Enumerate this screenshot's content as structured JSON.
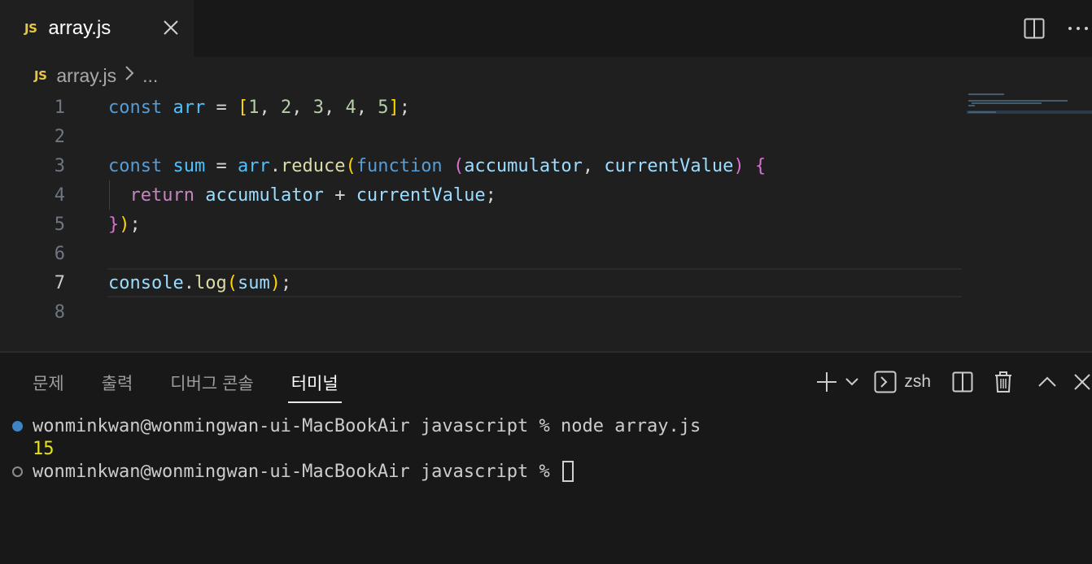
{
  "tab": {
    "badge": "JS",
    "title": "array.js"
  },
  "breadcrumb": {
    "badge": "JS",
    "file": "array.js",
    "more": "..."
  },
  "editor": {
    "line_numbers": [
      "1",
      "2",
      "3",
      "4",
      "5",
      "6",
      "7",
      "8"
    ],
    "active_line": "7",
    "lines": {
      "l1": [
        "const",
        "arr",
        "=",
        "[",
        "1",
        "2",
        "3",
        "4",
        "5",
        "]",
        ";"
      ],
      "l3": [
        "const",
        "sum",
        "=",
        "arr",
        "reduce",
        "(",
        "function",
        "(",
        "accumulator",
        "currentValue",
        ")",
        "{"
      ],
      "l4": [
        "return",
        "accumulator",
        "+",
        "currentValue",
        ";"
      ],
      "l5": [
        "}",
        ")",
        ";"
      ],
      "l7": [
        "console",
        "log",
        "(",
        "sum",
        ")",
        ";"
      ]
    }
  },
  "panel": {
    "tabs": [
      "문제",
      "출력",
      "디버그 콘솔",
      "터미널"
    ],
    "active_tab": "터미널",
    "shell": "zsh"
  },
  "terminal": {
    "prompt1": "wonminkwan@wonmingwan-ui-MacBookAir javascript % node array.js",
    "output": "15",
    "prompt2": "wonminkwan@wonmingwan-ui-MacBookAir javascript % "
  },
  "colors": {
    "keyword": "#569cd6",
    "return": "#c586c0",
    "variable": "#4fc1ff",
    "parameter": "#9cdcfe",
    "function": "#dcdcaa",
    "number": "#b5cea8",
    "bracket1": "#ffd700",
    "bracket2": "#da70d6",
    "bracket3": "#179fff",
    "js_badge": "#e8c54b",
    "terminal_output": "#e5e510",
    "success_dot": "#3d85c6"
  },
  "icons": [
    "close-icon",
    "split-editor-icon",
    "more-actions-icon",
    "chevron-right-icon",
    "plus-icon",
    "chevron-down-icon",
    "terminal-icon",
    "split-terminal-icon",
    "trash-icon",
    "chevron-up-icon",
    "close-panel-icon"
  ]
}
